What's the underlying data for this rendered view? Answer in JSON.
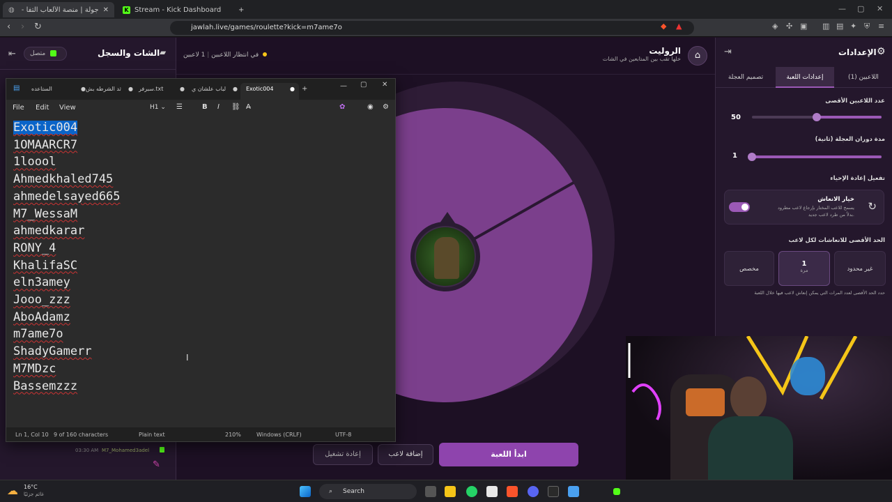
{
  "browser": {
    "tabs": [
      {
        "title": "جولة | منصة الألعاب التفا - Jawlah",
        "active": true
      },
      {
        "title": "Stream - Kick Dashboard",
        "active": false
      }
    ],
    "new_tab": "+",
    "url": "jawlah.live/games/roulette?kick=m7ame7o"
  },
  "chat": {
    "title": "الشات والسجل",
    "status": "متصل",
    "message": {
      "time": "03:30 AM",
      "user": "M7_Mohamed3adel"
    }
  },
  "center": {
    "status_players": "1 لاعبين",
    "status_waiting": "في انتظار اللاعبين",
    "game_title": "الروليت",
    "game_subtitle": "خلها تقب بين المتابعين في الشات",
    "buttons": {
      "restart": "إعادة تشغيل",
      "add_player": "إضافة لاعب",
      "start": "ابدأ اللعبة"
    }
  },
  "settings": {
    "title": "الإعدادات",
    "tabs": [
      "اللاعبين (1)",
      "إعدادات اللعبة",
      "تصميم العجلة"
    ],
    "max_players_label": "عدد اللاعبين الأقصى",
    "max_players_value": "50",
    "max_players_fraction": 0.5,
    "spin_duration_label": "مدة دوران العجلة (ثانية)",
    "spin_duration_value": "1",
    "spin_duration_fraction": 1.0,
    "revive_section": "تفعيل إعادة الإحياء",
    "revive_option_title": "خيار الانعاش",
    "revive_option_desc_1": "يسمح للاعب المختار بإرجاع لاعب مطرود",
    "revive_option_desc_2": "بدلاً من طرد لاعب جديد.",
    "revive_enabled": true,
    "max_revives_label": "الحد الأقصى للانعاشات لكل لاعب",
    "revive_options": [
      "غير محدود",
      "1",
      "مخصص"
    ],
    "revive_unit": "مرة",
    "revive_note": "حدد الحد الأقصى لعدد المرات التي يمكن إنعاش لاعب فيها خلال اللعبة"
  },
  "notepad": {
    "tabs": [
      "الستاعده",
      "ثد الشرطه بش",
      "سبرفر.txt",
      "لباب علشان ي",
      "Exotic004"
    ],
    "menu": [
      "File",
      "Edit",
      "View"
    ],
    "heading": "H1",
    "lines": [
      "Exotic004",
      "1OMAARCR7",
      "1loool",
      "Ahmedkhaled745",
      "ahmedelsayed665",
      "M7_WessaM",
      "ahmedkarar",
      "RONY_4",
      "KhalifaSC",
      "eln3amey",
      "Jooo_zzz",
      "AboAdamz",
      "m7ame7o",
      "ShadyGamerr",
      "M7MDzc",
      "Bassemzzz"
    ],
    "status": {
      "position": "Ln 1, Col 10",
      "chars": "9 of 160 characters",
      "format": "Plain text",
      "zoom": "210%",
      "eol": "Windows (CRLF)",
      "encoding": "UTF-8"
    }
  },
  "taskbar": {
    "weather_temp": "16°C",
    "weather_desc": "غائم جزئيًا",
    "search": "Search"
  },
  "colors": {
    "accent": "#8e44ad",
    "kick_green": "#53fc18",
    "wheel": "#7b3f8c"
  }
}
